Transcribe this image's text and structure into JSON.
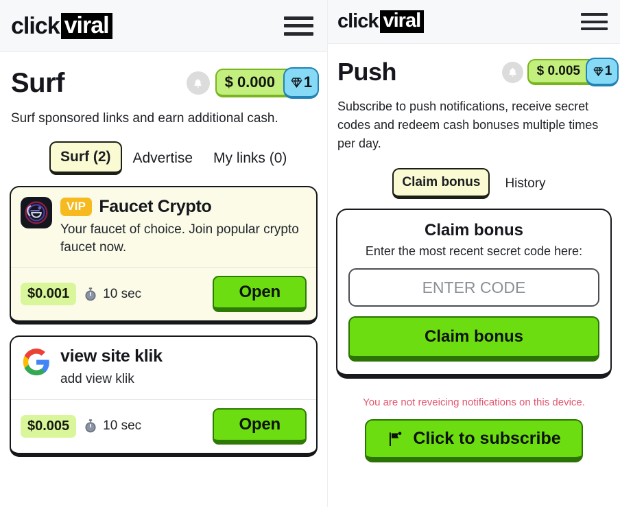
{
  "brand": {
    "part1": "click",
    "part2": "viral"
  },
  "icons": {
    "menu": "hamburger-menu-icon",
    "bell": "bell-icon",
    "gem": "gem-icon",
    "stopwatch": "stopwatch-icon",
    "flag": "flag-icon",
    "google": "google-logo-icon",
    "faucet": "faucet-crypto-logo-icon"
  },
  "colors": {
    "accent_green": "#6cdd10",
    "pill_green": "#c3ef7e",
    "price_green": "#d9f79a",
    "gem_blue": "#86daf5",
    "vip_amber": "#f6b91f",
    "tab_active": "#fafbd2",
    "notice_red": "#e2556e",
    "header_bg": "#f7f8fa"
  },
  "surf": {
    "title": "Surf",
    "balance": {
      "cash": "$ 0.000",
      "gems": "1"
    },
    "description": "Surf sponsored links and earn additional cash.",
    "tabs": [
      {
        "label": "Surf (2)",
        "active": true
      },
      {
        "label": "Advertise",
        "active": false
      },
      {
        "label": "My links (0)",
        "active": false
      }
    ],
    "offers": [
      {
        "vip": "VIP",
        "title": "Faucet Crypto",
        "description": "Your faucet of choice. Join popular crypto faucet now.",
        "price": "$0.001",
        "duration": "10 sec",
        "action": "Open",
        "icon": "faucet-crypto-logo-icon"
      },
      {
        "vip": "",
        "title": "view site klik",
        "description": "add view klik",
        "price": "$0.005",
        "duration": "10 sec",
        "action": "Open",
        "icon": "google-logo-icon"
      }
    ]
  },
  "push": {
    "title": "Push",
    "balance": {
      "cash": "$ 0.005",
      "gems": "1"
    },
    "description": "Subscribe to push notifications, receive secret codes and redeem cash bonuses multiple times per day.",
    "tabs": [
      {
        "label": "Claim bonus",
        "active": true
      },
      {
        "label": "History",
        "active": false
      }
    ],
    "bonus_card": {
      "title": "Claim bonus",
      "subtitle": "Enter the most recent secret code here:",
      "input_value": "",
      "input_placeholder": "ENTER CODE",
      "submit_label": "Claim bonus"
    },
    "notice": "You are not reveicing notifications on this device.",
    "subscribe_label": "Click to subscribe"
  }
}
